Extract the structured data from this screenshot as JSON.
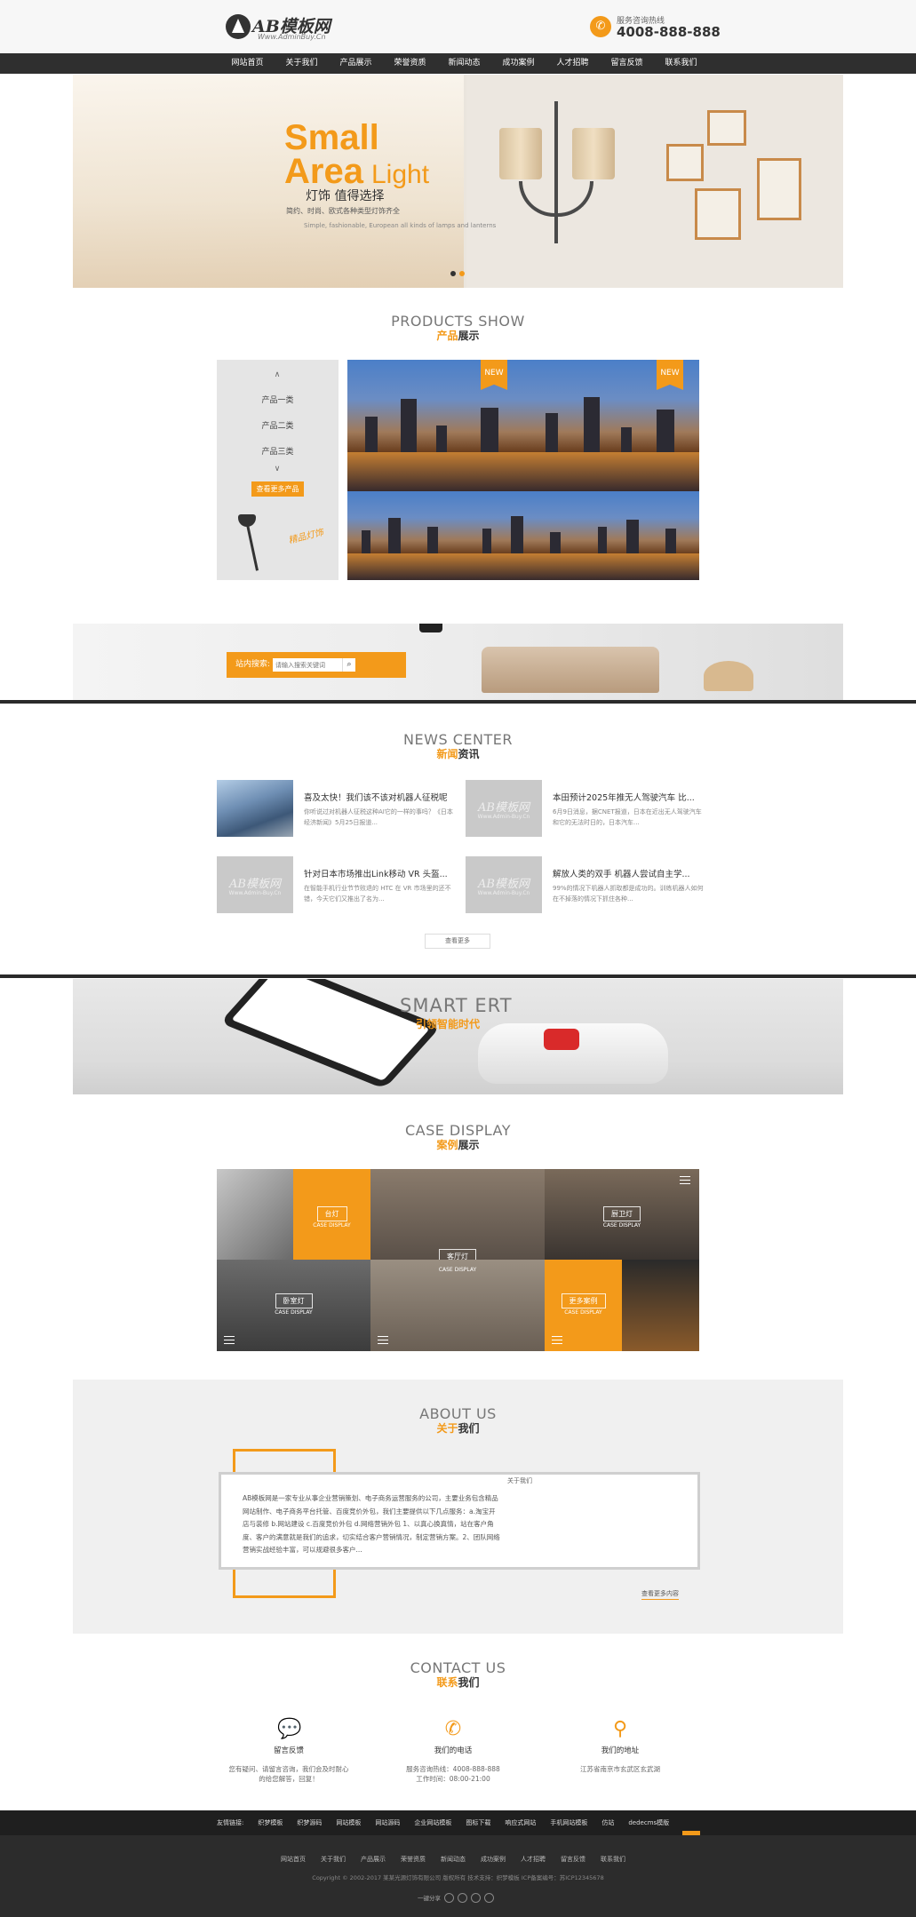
{
  "header": {
    "logo_text": "AB模板网",
    "logo_sub": "Www.AdminBuy.Cn",
    "hotline_label": "服务咨询热线",
    "hotline_number": "4008-888-888"
  },
  "nav": [
    "网站首页",
    "关于我们",
    "产品展示",
    "荣誉资质",
    "新闻动态",
    "成功案例",
    "人才招聘",
    "留言反馈",
    "联系我们"
  ],
  "banner": {
    "line1": "Small",
    "line2": "Area",
    "line3": "Light",
    "slogan": "灯饰 值得选择",
    "desc": "简约、时尚、欧式各种类型灯饰齐全",
    "desc_en": "Simple, fashionable, European all kinds of lamps and lanterns"
  },
  "products": {
    "title_en": "PRODUCTS SHOW",
    "title_cn_hl": "产品",
    "title_cn": "展示",
    "categories": [
      "产品一类",
      "产品二类",
      "产品三类"
    ],
    "more_button": "查看更多产品",
    "badge": "NEW",
    "signature": "精品灯饰"
  },
  "search": {
    "label": "站内搜索:",
    "placeholder": "请输入搜索关键词"
  },
  "news": {
    "title_en": "NEWS CENTER",
    "title_cn_hl": "新闻",
    "title_cn": "资讯",
    "placeholder_logo": "AB模板网",
    "placeholder_sub": "Www.Admin-Buy.Cn",
    "items": [
      {
        "title": "喜及太快！我们该不该对机器人征税呢",
        "desc": "你听说过对机器人征税这种AI它的一样的事吗？《日本经济新闻》5月25日报道..."
      },
      {
        "title": "本田预计2025年推无人驾驶汽车 比...",
        "desc": "6月9日消息，据CNET报道，日本在近出无人驾驶汽车和它的无法时日的，日本汽车..."
      },
      {
        "title": "针对日本市场推出Link移动 VR 头盔...",
        "desc": "在智能手机行业节节败退的 HTC 在 VR 市场里的还不错，今天它们又推出了名为..."
      },
      {
        "title": "解放人类的双手 机器人尝试自主学...",
        "desc": "99%的情况下机器人抓取都是成功的。训练机器人如何在不掉落的情况下抓住各种..."
      }
    ],
    "more": "查看更多"
  },
  "smart": {
    "title_en": "SMART ERT",
    "title_cn": "引领智能时代"
  },
  "cases": {
    "title_en": "CASE DISPLAY",
    "title_cn_hl": "案例",
    "title_cn": "展示",
    "items": [
      {
        "label": "台灯",
        "sub": "CASE DISPLAY"
      },
      {
        "label": "厨卫灯",
        "sub": "CASE DISPLAY"
      },
      {
        "label": "客厅灯",
        "sub": "CASE DISPLAY"
      },
      {
        "label": "卧室灯",
        "sub": "CASE DISPLAY"
      },
      {
        "label": "更多案例",
        "sub": "CASE DISPLAY"
      }
    ]
  },
  "about": {
    "title_en": "ABOUT US",
    "title_cn_hl": "关于",
    "title_cn": "我们",
    "text": "AB模板网是一家专业从事企业营销策划、电子商务运营服务的公司，主要业务包含精品网站制作、电子商务平台托管、百度竞价外包，我们主要提供以下几点服务：a.淘宝开店与装修 b.网站建设 c.百度竞价外包 d.网络营销外包 1、以真心换真情，站在客户角度、客户的满意就是我们的追求，切实结合客户营销情况，制定营销方案。2、团队网络营销实战经验丰富，可以规避很多客户...",
    "image_alt": "关于我们",
    "more": "查看更多内容"
  },
  "contact": {
    "title_en": "CONTACT US",
    "title_cn_hl": "联系",
    "title_cn": "我们",
    "items": [
      {
        "head": "留言反馈",
        "line1": "您有疑问、请留言咨询，我们会及时耐心",
        "line2": "的给您解答，回复！"
      },
      {
        "head": "我们的电话",
        "line1": "服务咨询热线：4008-888-888",
        "line2": "工作时间：08:00-21:00"
      },
      {
        "head": "我们的地址",
        "line1": "江苏省南京市玄武区玄武湖",
        "line2": ""
      }
    ]
  },
  "links": [
    "友情链接:",
    "织梦模板",
    "织梦源码",
    "网站模板",
    "网站源码",
    "企业网站模板",
    "图标下载",
    "响应式网站",
    "手机网站模板",
    "仿站",
    "dedecms模版"
  ],
  "footer": {
    "nav": [
      "网站首页",
      "关于我们",
      "产品展示",
      "荣誉资质",
      "新闻动态",
      "成功案例",
      "人才招聘",
      "留言反馈",
      "联系我们"
    ],
    "copyright": "Copyright © 2002-2017 某某光源灯饰有限公司 版权所有  技术支持：织梦模板  ICP备案编号：苏ICP12345678",
    "share_label": "一键分享",
    "to_top": "↑"
  }
}
